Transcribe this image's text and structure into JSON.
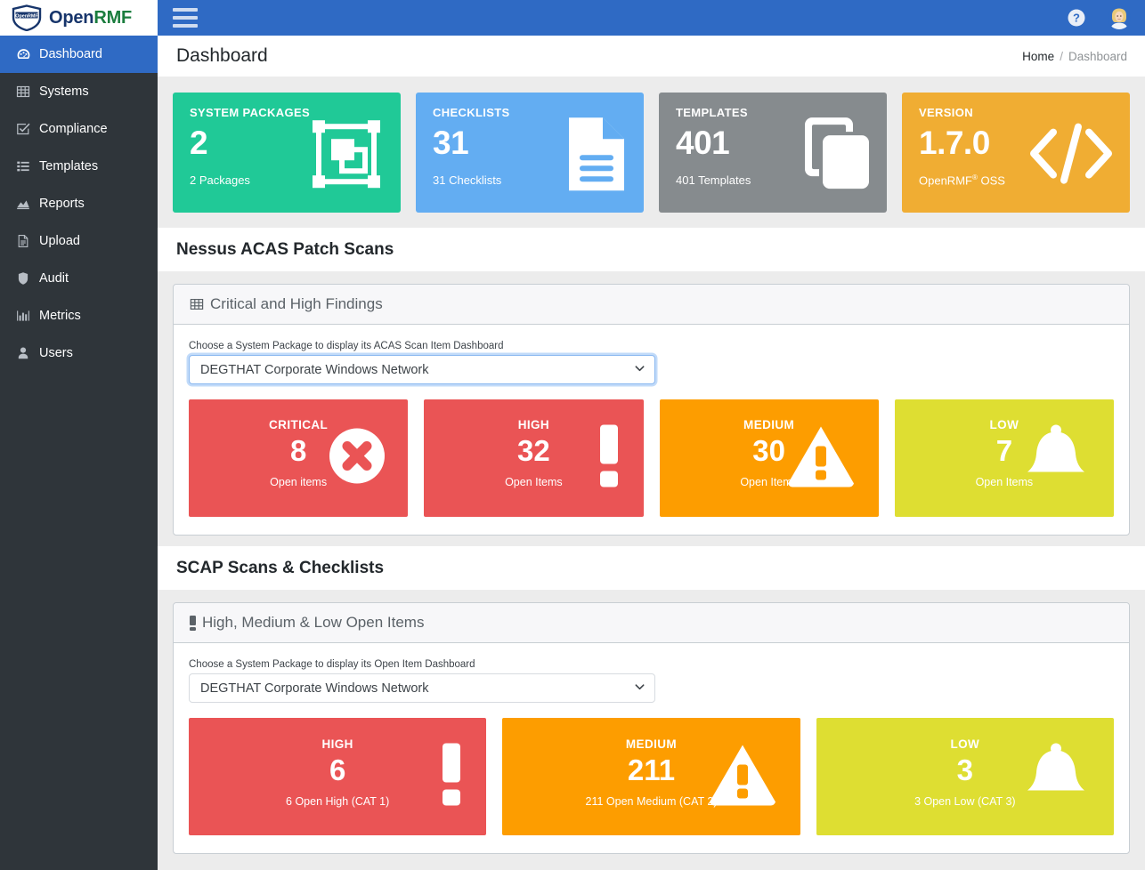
{
  "brand": {
    "logo_badge": "OpenRMF",
    "name_part1": "Open",
    "name_part2": "RMF"
  },
  "topbar": {
    "menu_icon": "hamburger-icon",
    "help_icon": "help-circle-icon",
    "avatar_icon": "user-avatar"
  },
  "sidebar": {
    "items": [
      {
        "label": "Dashboard",
        "icon": "speedometer-icon",
        "active": true
      },
      {
        "label": "Systems",
        "icon": "grid-icon",
        "active": false
      },
      {
        "label": "Compliance",
        "icon": "check-square-icon",
        "active": false
      },
      {
        "label": "Templates",
        "icon": "list-icon",
        "active": false
      },
      {
        "label": "Reports",
        "icon": "chart-area-icon",
        "active": false
      },
      {
        "label": "Upload",
        "icon": "document-icon",
        "active": false
      },
      {
        "label": "Audit",
        "icon": "shield-icon",
        "active": false
      },
      {
        "label": "Metrics",
        "icon": "bar-chart-icon",
        "active": false
      },
      {
        "label": "Users",
        "icon": "person-icon",
        "active": false
      }
    ]
  },
  "page": {
    "title": "Dashboard",
    "breadcrumb": {
      "home": "Home",
      "separator": "/",
      "current": "Dashboard"
    }
  },
  "stat_cards": [
    {
      "title": "SYSTEM PACKAGES",
      "value": "2",
      "sub": "2 Packages",
      "sub_sup": "",
      "sub_tail": "",
      "color": "#20c997",
      "icon": "packages-icon"
    },
    {
      "title": "CHECKLISTS",
      "value": "31",
      "sub": "31 Checklists",
      "sub_sup": "",
      "sub_tail": "",
      "color": "#63adf2",
      "icon": "document-lines-icon"
    },
    {
      "title": "TEMPLATES",
      "value": "401",
      "sub": "401 Templates",
      "sub_sup": "",
      "sub_tail": "",
      "color": "#868b8e",
      "icon": "copy-icon"
    },
    {
      "title": "VERSION",
      "value": "1.7.0",
      "sub": "OpenRMF",
      "sub_sup": "®",
      "sub_tail": " OSS",
      "color": "#f0ad33",
      "icon": "code-icon"
    }
  ],
  "sections": [
    {
      "id": "acas",
      "title": "Nessus ACAS Patch Scans",
      "panel_title": "Critical and High Findings",
      "panel_icon": "table-grid-icon",
      "select_label": "Choose a System Package to display its ACAS Scan Item Dashboard",
      "select_value": "DEGTHAT Corporate Windows Network",
      "select_focused": true,
      "cards": [
        {
          "title": "CRITICAL",
          "value": "8",
          "sub": "Open items",
          "color": "#ea5455",
          "icon": "x-circle-icon"
        },
        {
          "title": "HIGH",
          "value": "32",
          "sub": "Open Items",
          "color": "#ea5455",
          "icon": "exclamation-icon"
        },
        {
          "title": "MEDIUM",
          "value": "30",
          "sub": "Open Items",
          "color": "#fd9d00",
          "icon": "warning-triangle-icon"
        },
        {
          "title": "LOW",
          "value": "7",
          "sub": "Open Items",
          "color": "#dede32",
          "icon": "bell-icon"
        }
      ]
    },
    {
      "id": "scap",
      "title": "SCAP Scans & Checklists",
      "panel_title": "High, Medium & Low Open Items",
      "panel_icon": "exclamation-icon",
      "select_label": "Choose a System Package to display its Open Item Dashboard",
      "select_value": "DEGTHAT Corporate Windows Network",
      "select_focused": false,
      "cards": [
        {
          "title": "HIGH",
          "value": "6",
          "sub": "6 Open High (CAT 1)",
          "color": "#ea5455",
          "icon": "exclamation-icon"
        },
        {
          "title": "MEDIUM",
          "value": "211",
          "sub": "211 Open Medium (CAT 2)",
          "color": "#fd9d00",
          "icon": "warning-triangle-icon"
        },
        {
          "title": "LOW",
          "value": "3",
          "sub": "3 Open Low (CAT 3)",
          "color": "#dede32",
          "icon": "bell-icon"
        }
      ]
    }
  ],
  "colors": {
    "brand_blue": "#2f6ac4",
    "sidebar_dark": "#2f353a",
    "page_bg": "#ececec"
  }
}
